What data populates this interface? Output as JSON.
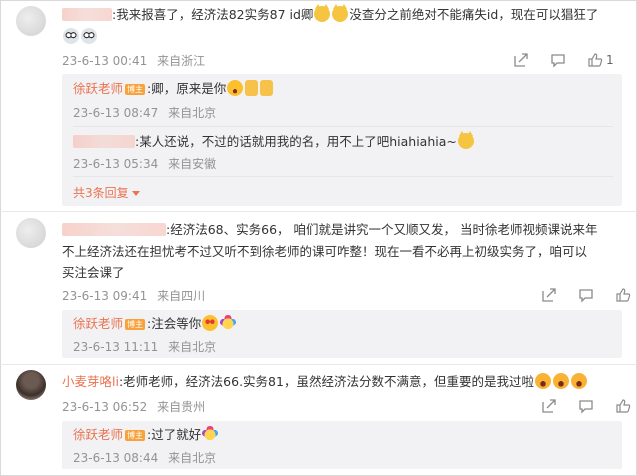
{
  "comments": [
    {
      "text_before": ":我来报喜了，经济法82实务87  id卿",
      "text_after": "没查分之前绝对不能痛失id，现在可以猖狂了",
      "time": "23-6-13 00:41",
      "location": "来自浙江",
      "like_count": "1",
      "replies": [
        {
          "author": "徐跃老师",
          "badge": "博主",
          "text": ":卿，原来是你",
          "time": "23-6-13 08:47",
          "location": "来自北京"
        },
        {
          "text": ":某人还说，不过的话就用我的名，用不上了吧hiahiahia~",
          "time": "23-6-13 05:34",
          "location": "来自安徽"
        }
      ],
      "more_replies": "共3条回复"
    },
    {
      "text_line1": ":经济法68、实务66， 咱们就是讲究一个又顺又发， 当时徐老师视频课说来年",
      "text_line2": "不上经济法还在担忧考不过又听不到徐老师的课可咋整！现在一看不必再上初级实务了，咱可以",
      "text_line3": "买注会课了",
      "time": "23-6-13 09:41",
      "location": "来自四川",
      "replies": [
        {
          "author": "徐跃老师",
          "badge": "博主",
          "text": ":注会等你",
          "time": "23-6-13 11:11",
          "location": "来自北京"
        }
      ]
    },
    {
      "author": "小麦芽咯li",
      "text": ":老师老师，经济法66.实务81，虽然经济法分数不满意，但重要的是我过啦",
      "time": "23-6-13 06:52",
      "location": "来自贵州",
      "replies": [
        {
          "author": "徐跃老师",
          "badge": "博主",
          "text": ":过了就好",
          "time": "23-6-13 08:44",
          "location": "来自北京"
        }
      ]
    }
  ],
  "icons": {
    "share": "share-icon",
    "comment": "comment-icon",
    "like": "thumbs-up-icon"
  },
  "colors": {
    "link": "#eb7350",
    "meta": "#939393",
    "reply_bg": "#f2f2f5",
    "badge": "#f7a23a"
  }
}
